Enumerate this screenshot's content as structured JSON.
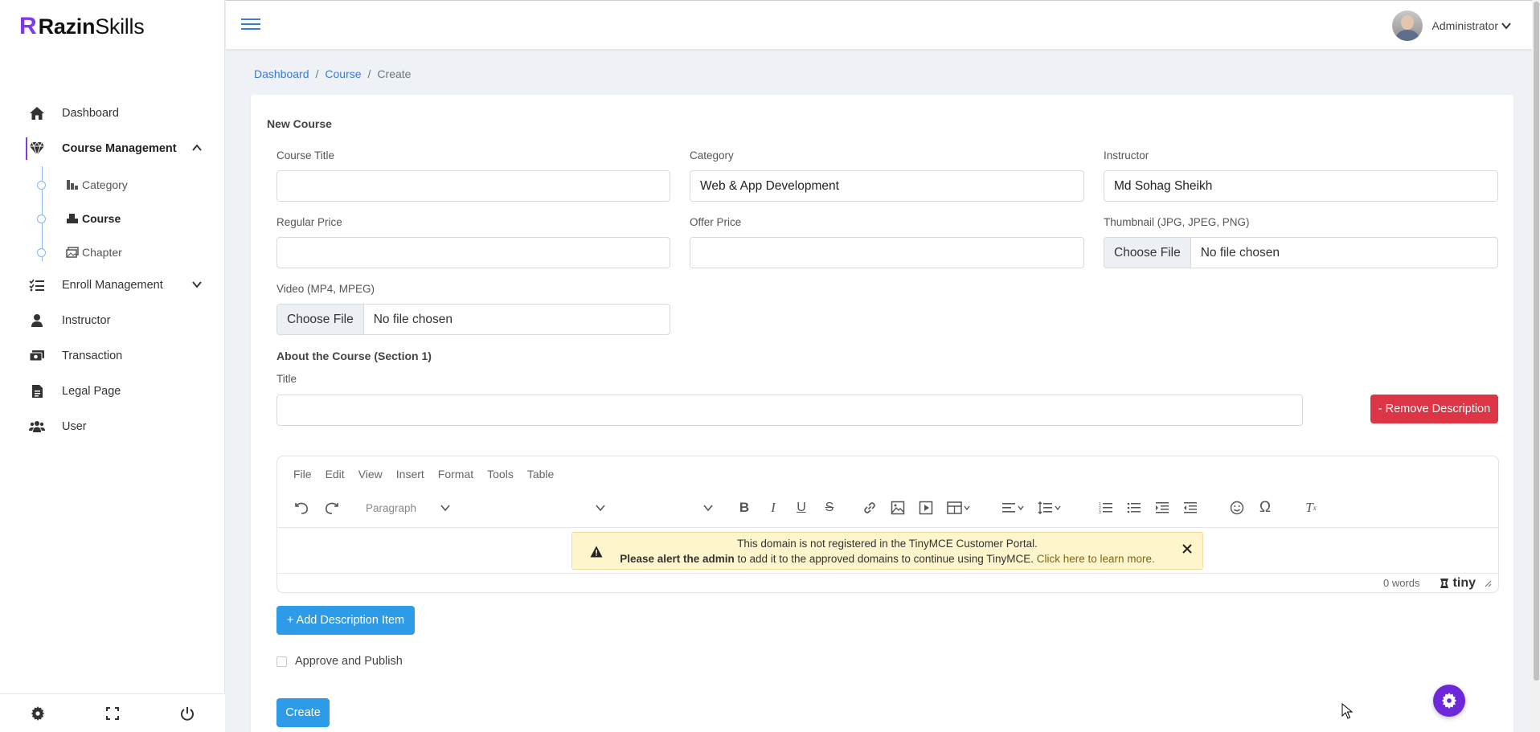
{
  "brand": {
    "mark": "R",
    "name_bold": "Razin",
    "name_light": "Skills",
    "accent": "#7c3aed"
  },
  "sidebar": {
    "items": [
      {
        "label": "Dashboard",
        "icon": "home-icon"
      },
      {
        "label": "Course Management",
        "icon": "gem-icon",
        "active": true,
        "expanded": true
      },
      {
        "label": "Enroll Management",
        "icon": "list-check-icon"
      },
      {
        "label": "Instructor",
        "icon": "person-icon"
      },
      {
        "label": "Transaction",
        "icon": "money-icon"
      },
      {
        "label": "Legal Page",
        "icon": "file-icon"
      },
      {
        "label": "User",
        "icon": "users-icon"
      }
    ],
    "sub_items": [
      {
        "label": "Category",
        "icon": "chart-icon"
      },
      {
        "label": "Course",
        "icon": "boxes-icon",
        "active": true
      },
      {
        "label": "Chapter",
        "icon": "images-icon"
      }
    ],
    "footer": [
      "gear-icon",
      "expand-icon",
      "power-icon"
    ]
  },
  "topbar": {
    "user_name": "Administrator"
  },
  "breadcrumb": {
    "items": [
      "Dashboard",
      "Course",
      "Create"
    ],
    "sep": "/"
  },
  "form": {
    "card_title": "New Course",
    "course_title_label": "Course Title",
    "course_title_value": "",
    "category_label": "Category",
    "category_value": "Web & App Development",
    "instructor_label": "Instructor",
    "instructor_value": "Md Sohag Sheikh",
    "regular_price_label": "Regular Price",
    "regular_price_value": "",
    "offer_price_label": "Offer Price",
    "offer_price_value": "",
    "thumbnail_label": "Thumbnail (JPG, JPEG, PNG)",
    "video_label": "Video (MP4, MPEG)",
    "choose_file": "Choose File",
    "no_file": "No file chosen",
    "section_title": "About the Course (Section 1)",
    "title_label": "Title",
    "title_value": "",
    "remove_button": "- Remove Description",
    "add_button": "+ Add Description Item",
    "approve_label": "Approve and Publish",
    "approve_checked": false,
    "create_button": "Create"
  },
  "editor": {
    "menu": [
      "File",
      "Edit",
      "View",
      "Insert",
      "Format",
      "Tools",
      "Table"
    ],
    "block_format": "Paragraph",
    "warning_line1": "This domain is not registered in the TinyMCE Customer Portal.",
    "warning_bold": "Please alert the admin",
    "warning_line2": " to add it to the approved domains to continue using TinyMCE.",
    "warning_link": "Click here to learn more.",
    "word_count": "0 words",
    "brand": "tiny"
  },
  "colors": {
    "primary": "#2d9be8",
    "danger": "#dc3545",
    "link": "#3a7bd5",
    "warning_bg": "#fff5cc"
  }
}
